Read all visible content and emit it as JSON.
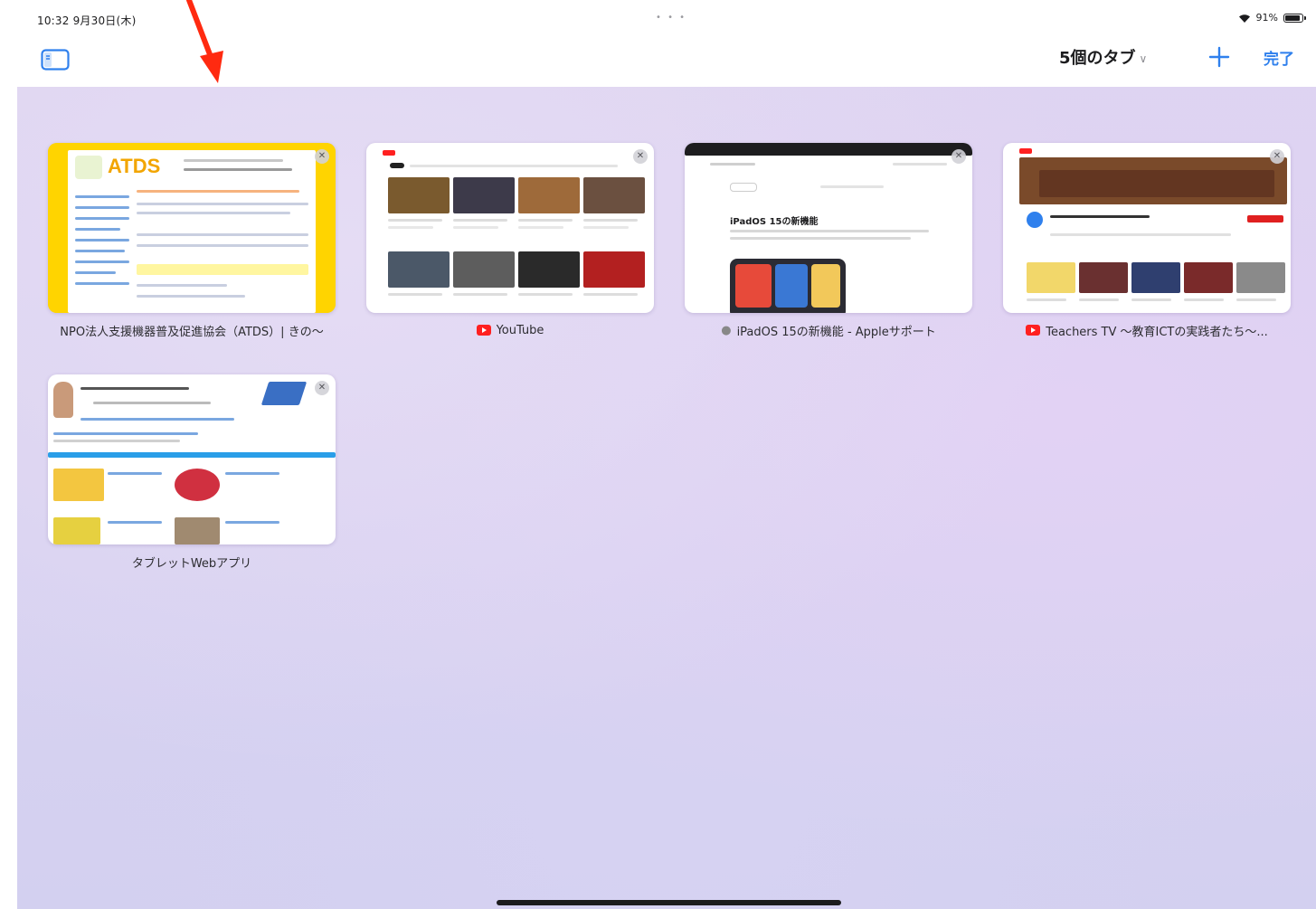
{
  "status_bar": {
    "time": "10:32 9月30日(木)",
    "dots": "• • •",
    "battery": "91%"
  },
  "toolbar": {
    "tab_count_label": "5個のタブ",
    "done_label": "完了"
  },
  "tabs": [
    {
      "title": "NPO法人支援機器普及促進協会（ATDS）| きの～",
      "favicon": "none"
    },
    {
      "title": "YouTube",
      "favicon": "youtube-icon"
    },
    {
      "title": "iPadOS 15の新機能 - Appleサポート",
      "favicon": "apple-icon"
    },
    {
      "title": "Teachers TV ～教育ICTの実践者たち～...",
      "favicon": "youtube-icon"
    },
    {
      "title": "タブレットWebアプリ",
      "favicon": "none"
    }
  ],
  "thumbnails": {
    "atds_logo": "ATDS",
    "ipados_heading": "iPadOS 15の新機能"
  },
  "colors": {
    "accent": "#2f80ed",
    "annotation_arrow": "#ff2a10",
    "background": "#d8d2f1"
  }
}
